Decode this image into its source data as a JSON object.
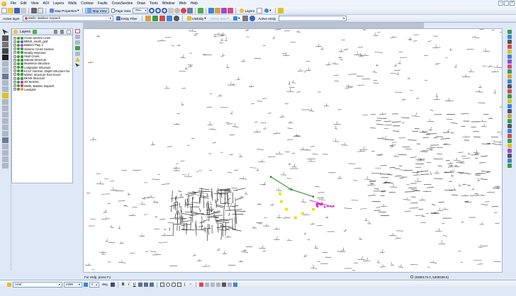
{
  "menu": {
    "items": [
      "File",
      "Edit",
      "View",
      "AOI",
      "Layers",
      "Wells",
      "Contour",
      "Faults",
      "CrossSection",
      "Draw",
      "Tools",
      "Window",
      "Web",
      "Help"
    ]
  },
  "toolbar": {
    "map_properties": "Map Properties",
    "map_view": "Map View",
    "page_view": "Page View",
    "zoom": "75%",
    "layers": "Layers",
    "active_layer_label": "Active layer",
    "active_layer_value": "Wells, Bakken Isopach",
    "entity_filter": "Entity Filter",
    "visibility": "Visibility",
    "check_item": "Check Item",
    "active_entity": "Active entity"
  },
  "layers_panel": {
    "title": "Layers",
    "items": [
      {
        "label": "Cross Section Lines",
        "color": "#6b8e3a"
      },
      {
        "label": "BBNS_south_grid",
        "color": "#3b7bd8"
      },
      {
        "label": "Bakken Play 1",
        "color": "#c24ab0"
      },
      {
        "label": "Seismic Cross Section",
        "color": "#3a9c4a"
      },
      {
        "label": "Muddy Structure",
        "color": "#3a9c4a"
      },
      {
        "label": "Skull Creek",
        "color": "#3a9c4a"
      },
      {
        "label": "Dakota Structure",
        "color": "#3a9c4a"
      },
      {
        "label": "Mowrison Structure",
        "color": "#3a9c4a"
      },
      {
        "label": "Lodgepole Structure",
        "color": "#3a9c4a"
      },
      {
        "label": "KCLF Horizon, Depth Structure No",
        "color": "#3a9c4a"
      },
      {
        "label": "MSNC Structure from Excel",
        "color": "#3a9c4a"
      },
      {
        "label": "BKNS Structure",
        "color": "#3a9c4a"
      },
      {
        "label": "3D Seismic",
        "color": "#9a4ad8"
      },
      {
        "label": "Wells, Bakken Isopach",
        "color": "#d84a4a"
      },
      {
        "label": "Landgrid",
        "color": "#d8a04a"
      }
    ]
  },
  "status": {
    "help": "For Help, press F1",
    "coords": "(9380170.0, 5408338.5)"
  },
  "format": {
    "font": "Arial",
    "size": "2286",
    "spacing": "0",
    "unit": "deg"
  },
  "colors": {
    "accent": "#7f9cc6",
    "section_line": "#2c8a2c",
    "highlight_wells": "#f0e000",
    "selected_wells": "#e030d0"
  }
}
